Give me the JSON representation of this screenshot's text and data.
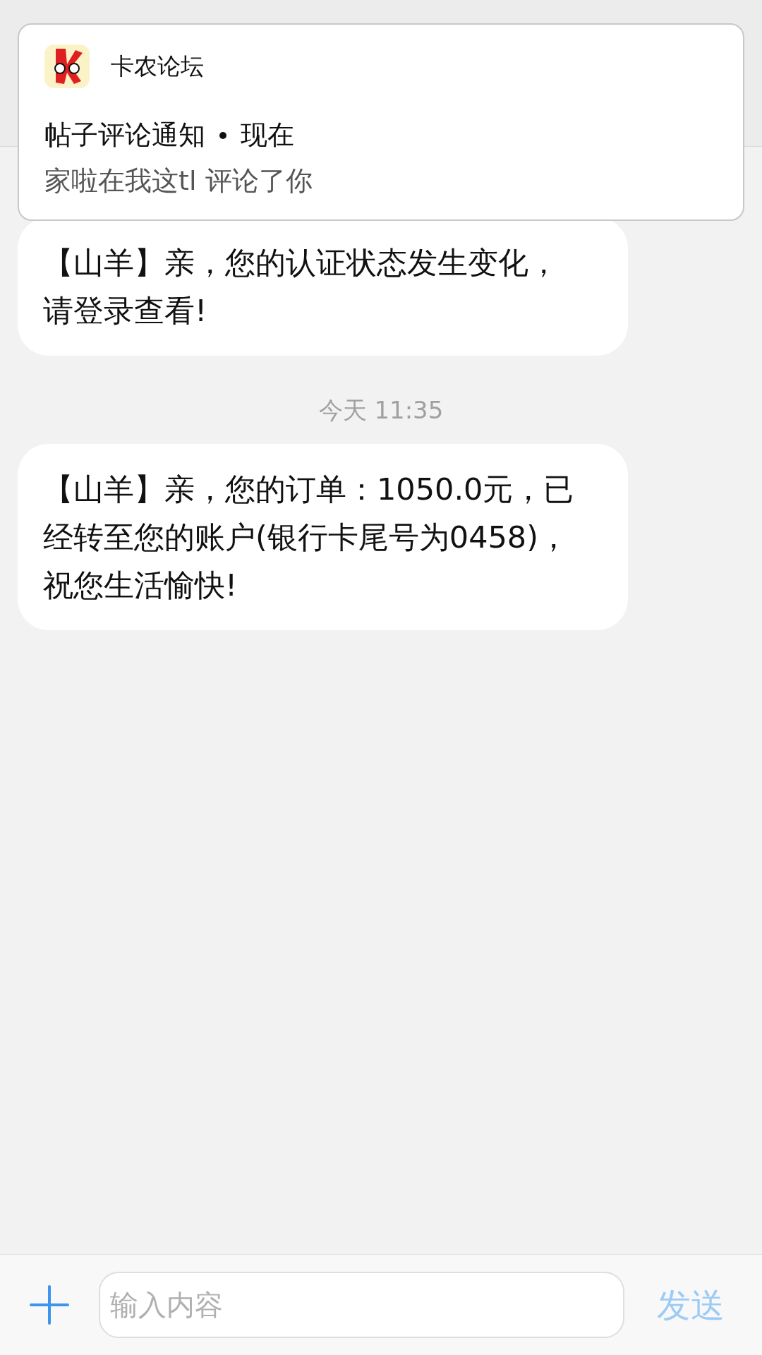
{
  "notification": {
    "app": "卡农论坛",
    "title": "帖子评论通知",
    "time": "现在",
    "body": "家啦在我这tl 评论了你"
  },
  "messages": [
    {
      "text": "【山羊】亲，您的认证状态发生变化，请登录查看!"
    },
    {
      "time": "今天 11:35",
      "text": "【山羊】亲，您的订单：1050.0元，已经转至您的账户(银行卡尾号为0458)，祝您生活愉快!"
    }
  ],
  "composer": {
    "placeholder": "输入内容",
    "send": "发送"
  }
}
